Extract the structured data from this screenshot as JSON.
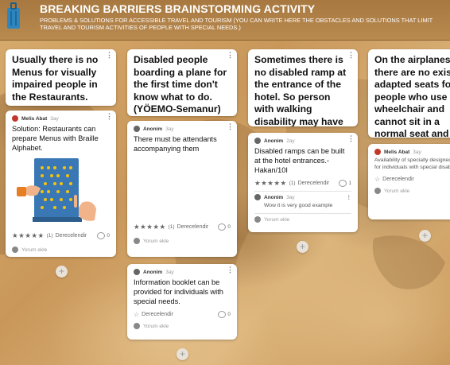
{
  "header": {
    "title": "BREAKING BARRIERS BRAINSTORMING ACTIVITY",
    "subtitle": "PROBLEMS & SOLUTIONS FOR ACCESSIBLE TRAVEL AND TOURISM (YOU CAN WRITE HERE THE OBSTACLES AND SOLUTIONS THAT LIMIT TRAVEL AND TOURISM ACTIVITIES OF PEOPLE WITH SPECIAL NEEDS.)"
  },
  "colors": {
    "header": "#a7783f",
    "avatar_melis": "#c0392b",
    "card": "#ffffff"
  },
  "columns": [
    {
      "header_post": "Usually there is no Menus for visually impaired people in the Restaurants.",
      "posts": [
        {
          "author": "Melis Abat",
          "age": "3ay",
          "text": "Solution: Restaurants can prepare Menus with Braille Alphabet.",
          "rating_count": "(1)",
          "rate_label": "Derecelendir",
          "comments": "0",
          "add_comment": "Yorum ekle"
        }
      ]
    },
    {
      "header_post": "Disabled people boarding a plane for the first time don't know what to do. (YÖEMO-Semanur)",
      "posts": [
        {
          "author": "Anonim",
          "age": "3ay",
          "text": "There must be attendants accompanying them",
          "rating_count": "(1)",
          "rate_label": "Derecelendir",
          "comments": "0",
          "add_comment": "Yorum ekle"
        },
        {
          "author": "Anonim",
          "age": "3ay",
          "text": "Information booklet can be provided for individuals with special needs.",
          "rate_label": "Derecelendir",
          "comments": "0",
          "add_comment": "Yorum ekle"
        }
      ]
    },
    {
      "header_post": "Sometimes there is no disabled ramp at the entrance of the hotel. So person with walking disability may have difficulty.",
      "posts": [
        {
          "author": "Anonim",
          "age": "2ay",
          "text": "Disabled ramps can be built at the hotel entrances.-Hakan/10I",
          "rating_count": "(1)",
          "rate_label": "Derecelendir",
          "comments": "1",
          "reply_author": "Anonim",
          "reply_age": "3ay",
          "reply_text": "Wow it is very good example",
          "add_comment": "Yorum ekle"
        }
      ]
    },
    {
      "header_post": "On the airplanes there are no exist adapted seats for people who use a wheelchair and cannot sit in a normal seat and need to remain in their wheelchair.",
      "posts": [
        {
          "author": "Melis Abat",
          "age": "3ay",
          "text": "Availability of specially designed seats for individuals with special disabilities",
          "rate_label": "Derecelendir",
          "add_comment": "Yorum ekle"
        }
      ]
    }
  ]
}
